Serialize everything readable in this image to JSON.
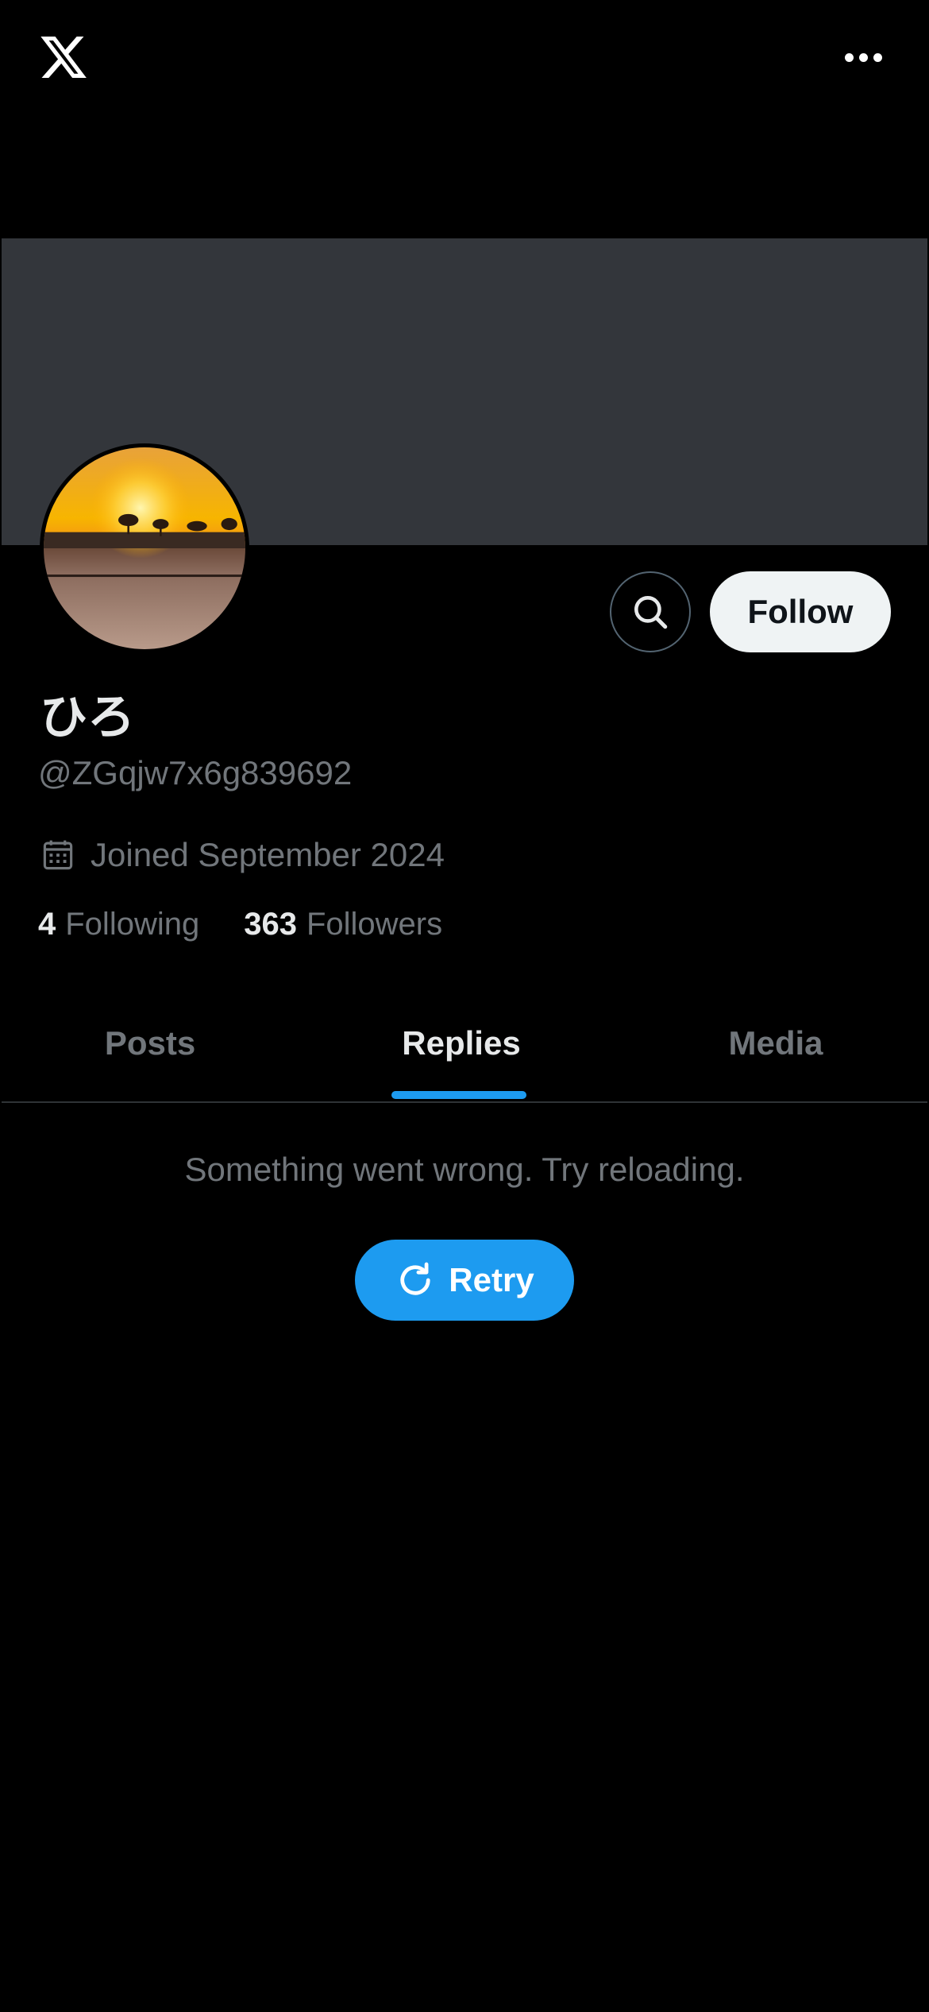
{
  "header": {
    "logo_icon": "x-logo-icon",
    "more_icon": "more-options-icon"
  },
  "profile": {
    "display_name": "ひろ",
    "handle": "@ZGqjw7x6g839692",
    "joined": "Joined September 2024",
    "following_count": "4",
    "following_label": "Following",
    "followers_count": "363",
    "followers_label": "Followers",
    "follow_button": "Follow",
    "search_icon": "search-icon",
    "calendar_icon": "calendar-icon"
  },
  "tabs": [
    {
      "label": "Posts",
      "active": false
    },
    {
      "label": "Replies",
      "active": true
    },
    {
      "label": "Media",
      "active": false
    }
  ],
  "content": {
    "error_message": "Something went wrong. Try reloading.",
    "retry_label": "Retry",
    "retry_icon": "refresh-icon"
  },
  "colors": {
    "background": "#000000",
    "banner": "#33363b",
    "accent": "#1d9bf0",
    "secondary_text": "#71767b"
  }
}
